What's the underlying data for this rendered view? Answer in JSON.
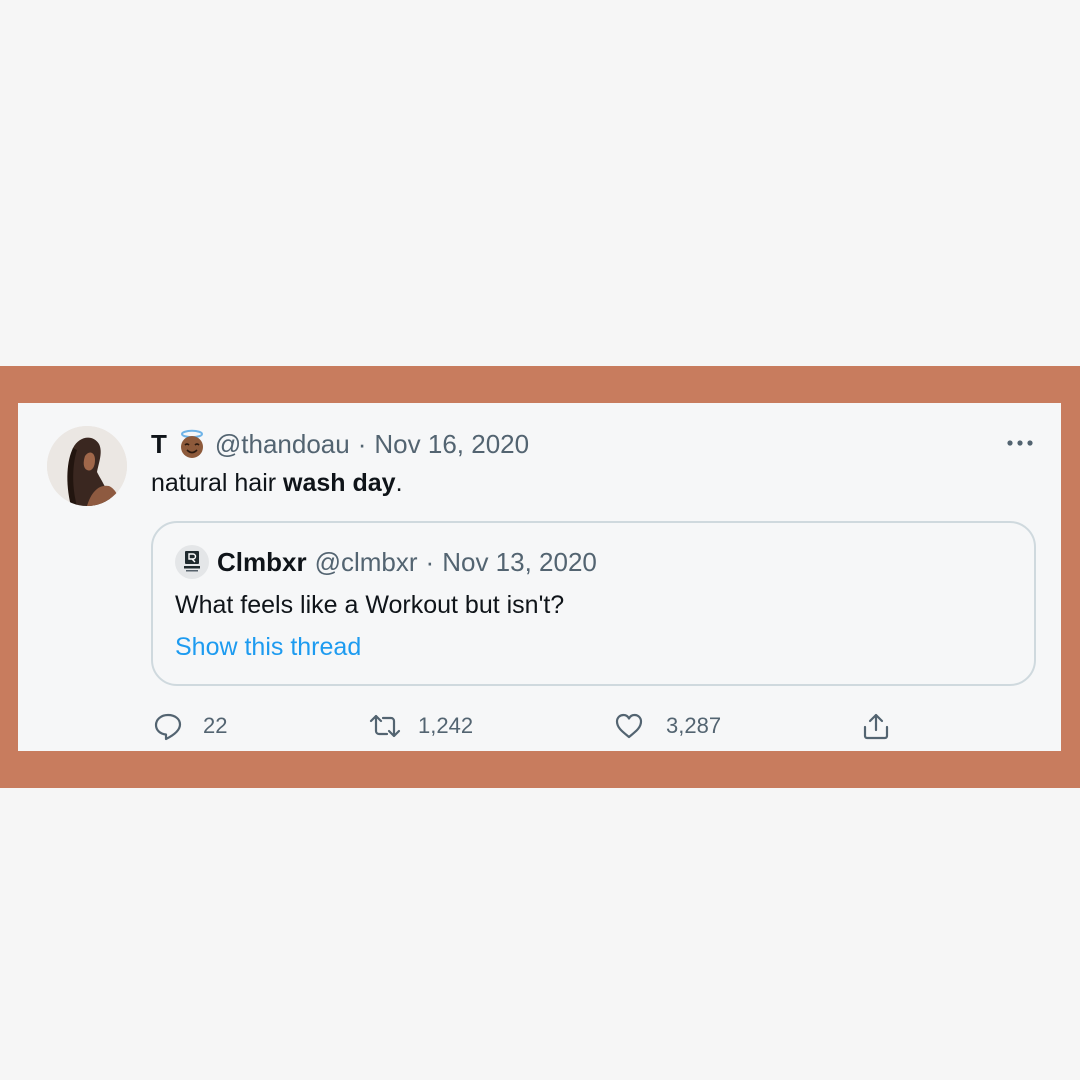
{
  "tweet": {
    "author_name": "T",
    "author_emoji": "angel-face-emoji",
    "handle": "@thandoau",
    "separator": "·",
    "date": "Nov 16, 2020",
    "text_plain": "natural hair ",
    "text_bold": "wash day",
    "text_end": ".",
    "more_icon": "more-horizontal-icon"
  },
  "quoted": {
    "name": "Clmbxr",
    "handle": "@clmbxr",
    "separator": "·",
    "date": "Nov 13, 2020",
    "text": "What feels like a Workout but isn't?",
    "link": "Show this thread"
  },
  "actions": {
    "replies": "22",
    "retweets": "1,242",
    "likes": "3,287",
    "reply_icon": "reply-icon",
    "retweet_icon": "retweet-icon",
    "like_icon": "heart-icon",
    "share_icon": "share-icon"
  },
  "colors": {
    "frame": "#c87c5e",
    "link": "#1d9bf0",
    "muted": "#536471",
    "text": "#0f1419"
  }
}
